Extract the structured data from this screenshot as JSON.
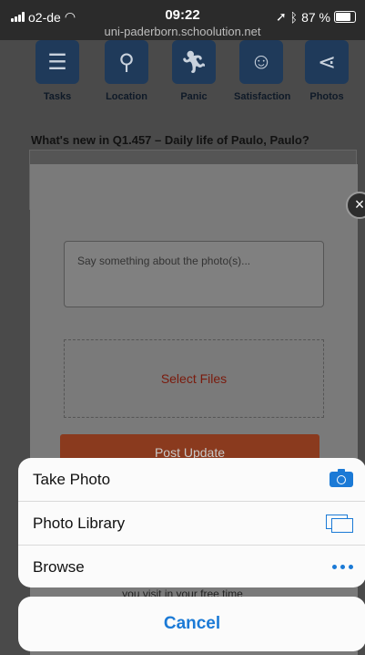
{
  "status_bar": {
    "carrier": "o2-de",
    "time": "09:22",
    "url": "uni-paderborn.schoolution.net",
    "battery": "87 %",
    "battery_level": 0.87
  },
  "toolbar": {
    "items": [
      {
        "label": "Tasks",
        "icon": "tasks-icon"
      },
      {
        "label": "Location",
        "icon": "location-pin-icon"
      },
      {
        "label": "Panic",
        "icon": "panic-runner-icon"
      },
      {
        "label": "Satisfaction",
        "icon": "smiley-icon"
      },
      {
        "label": "Photos",
        "icon": "share-icon"
      }
    ]
  },
  "page": {
    "title": "What's new in Q1.457 – Daily life of Paulo, Paulo?",
    "behind_text": "you visit in your free time"
  },
  "modal": {
    "photo_placeholder": "Say something about the photo(s)...",
    "select_files": "Select Files",
    "post_button": "Post Update"
  },
  "action_sheet": {
    "options": [
      {
        "label": "Take Photo",
        "icon": "camera-icon"
      },
      {
        "label": "Photo Library",
        "icon": "photo-library-icon"
      },
      {
        "label": "Browse",
        "icon": "more-dots-icon"
      }
    ],
    "cancel": "Cancel"
  },
  "colors": {
    "accent": "#1b7ad6",
    "post_button": "#8a3a1e",
    "select_files": "#7a1a0c"
  }
}
